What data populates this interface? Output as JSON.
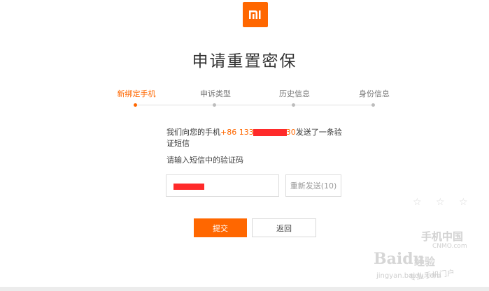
{
  "brand": {
    "logo_text": "MI",
    "color": "#ff6700"
  },
  "page": {
    "title": "申请重置密保"
  },
  "steps": [
    {
      "label": "新绑定手机",
      "active": true
    },
    {
      "label": "申诉类型",
      "active": false
    },
    {
      "label": "历史信息",
      "active": false
    },
    {
      "label": "身份信息",
      "active": false
    }
  ],
  "message": {
    "prefix": "我们向您的手机",
    "phone_start": "+86 133",
    "phone_end": "30",
    "suffix": "发送了一条验证短信"
  },
  "prompt": "请输入短信中的验证码",
  "code_input": {
    "value": ""
  },
  "resend_button": "重新发送(10)",
  "submit_button": "提交",
  "back_button": "返回",
  "watermark": {
    "stars": "☆ ☆ ☆",
    "site": "手机中国",
    "site_sub": "CNMO.com",
    "baidu": "Baidu",
    "jingyan": "经验",
    "url": "jingyan.baidu.com",
    "slogan": "专业手机门户"
  }
}
